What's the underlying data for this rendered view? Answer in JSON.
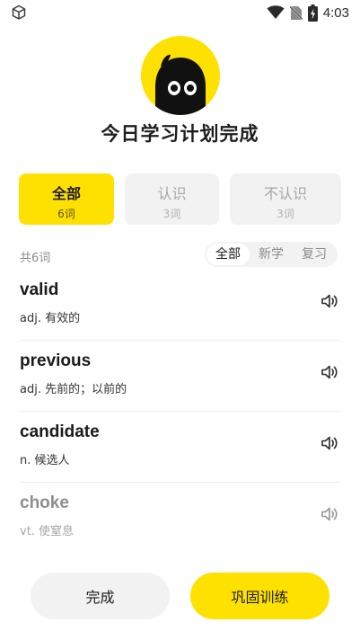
{
  "status_bar": {
    "time": "4:03",
    "icons": [
      "cube-icon",
      "wifi-icon",
      "no-sim-icon",
      "battery-charging-icon"
    ]
  },
  "header": {
    "title": "今日学习计划完成",
    "avatar_icon": "cartoon-face-icon"
  },
  "filters": [
    {
      "label": "全部",
      "count": "6词",
      "active": true
    },
    {
      "label": "认识",
      "count": "3词",
      "active": false
    },
    {
      "label": "不认识",
      "count": "3词",
      "active": false
    }
  ],
  "list_header": {
    "total": "共6词",
    "segments": [
      {
        "label": "全部",
        "active": true
      },
      {
        "label": "新学",
        "active": false
      },
      {
        "label": "复习",
        "active": false
      }
    ]
  },
  "words": [
    {
      "word": "valid",
      "meaning": "adj. 有效的"
    },
    {
      "word": "previous",
      "meaning": "adj. 先前的；以前的"
    },
    {
      "word": "candidate",
      "meaning": "n. 候选人"
    },
    {
      "word": "choke",
      "meaning": "vt. 使窒息"
    }
  ],
  "buttons": {
    "done": "完成",
    "train": "巩固训练"
  },
  "colors": {
    "accent": "#ffe100",
    "card_bg": "#f2f2f2",
    "text": "#1b1b1b",
    "muted": "#8a8a8a"
  }
}
